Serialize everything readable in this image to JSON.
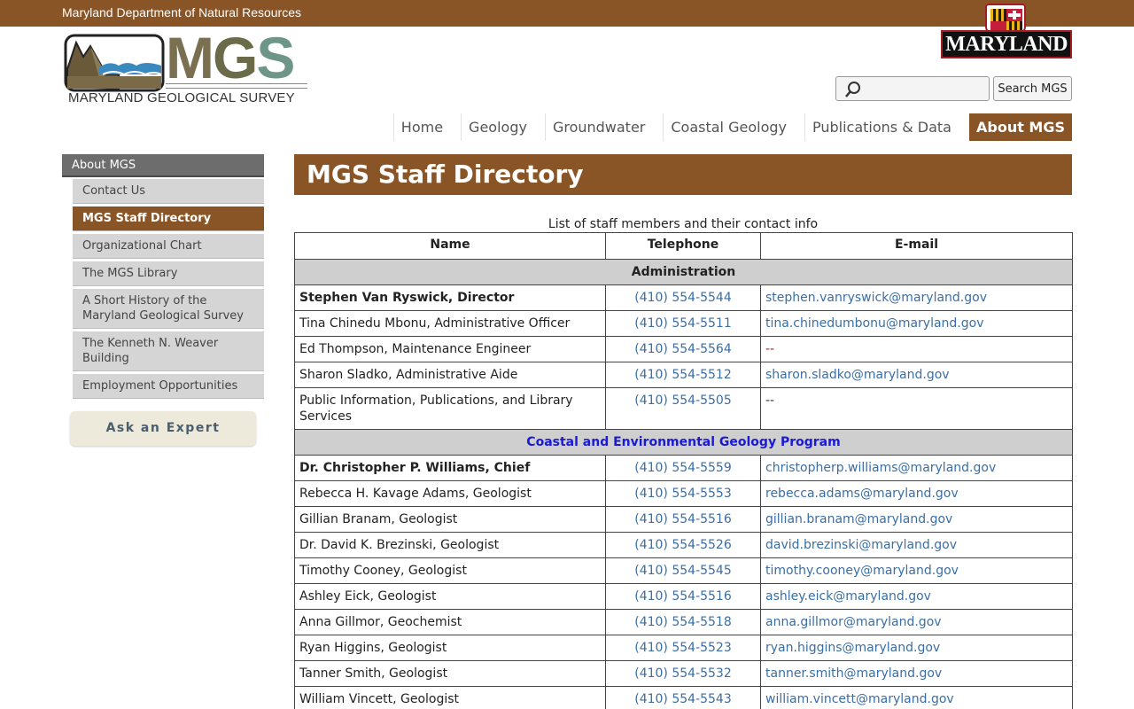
{
  "topbar": {
    "agency": "Maryland Department of Natural Resources"
  },
  "badge": {
    "word": "MARYLAND"
  },
  "logo": {
    "letters_m": "M",
    "letters_g": "G",
    "letters_s": "S",
    "subtitle": "MARYLAND GEOLOGICAL SURVEY"
  },
  "search": {
    "placeholder": "",
    "button": "Search MGS"
  },
  "nav": [
    {
      "label": "Home"
    },
    {
      "label": "Geology"
    },
    {
      "label": "Groundwater"
    },
    {
      "label": "Coastal Geology"
    },
    {
      "label": "Publications & Data"
    },
    {
      "label": "About MGS"
    }
  ],
  "sidebar": {
    "heading": "About MGS",
    "items": [
      {
        "label": "Contact Us"
      },
      {
        "label": "MGS Staff Directory"
      },
      {
        "label": "Organizational Chart"
      },
      {
        "label": "The MGS Library"
      },
      {
        "label": "A Short History of the Maryland Geological Survey"
      },
      {
        "label": "The Kenneth N. Weaver Building"
      },
      {
        "label": "Employment Opportunities"
      }
    ],
    "ask": "Ask an Expert"
  },
  "page": {
    "title": "MGS Staff Directory",
    "caption": "List of staff members and their contact info"
  },
  "table": {
    "headers": {
      "name": "Name",
      "tel": "Telephone",
      "mail": "E-mail"
    },
    "sections": [
      {
        "title": "Administration",
        "rows": [
          {
            "name": "Stephen Van Ryswick, Director",
            "tel": "(410) 554-5544",
            "mail": "stephen.vanryswick@maryland.gov"
          },
          {
            "name": "Tina Chinedu Mbonu, Administrative Officer",
            "tel": "(410) 554-5511",
            "mail": "tina.chinedumbonu@maryland.gov"
          },
          {
            "name": "Ed Thompson, Maintenance Engineer",
            "tel": "(410) 554-5564",
            "mail": "--"
          },
          {
            "name": "Sharon Sladko, Administrative Aide",
            "tel": "(410) 554-5512",
            "mail": "sharon.sladko@maryland.gov"
          },
          {
            "name": "Public Information, Publications, and Library Services",
            "tel": "(410) 554-5505",
            "mail": "--"
          }
        ]
      },
      {
        "title": "Coastal and Environmental Geology Program",
        "rows": [
          {
            "name": "Dr. Christopher P. Williams, Chief",
            "tel": "(410) 554-5559",
            "mail": "christopherp.williams@maryland.gov"
          },
          {
            "name": "Rebecca H. Kavage Adams, Geologist",
            "tel": "(410) 554-5553",
            "mail": "rebecca.adams@maryland.gov"
          },
          {
            "name": "Gillian Branam, Geologist",
            "tel": "(410) 554-5516",
            "mail": "gillian.branam@maryland.gov"
          },
          {
            "name": "Dr. David K. Brezinski, Geologist",
            "tel": "(410) 554-5526",
            "mail": "david.brezinski@maryland.gov"
          },
          {
            "name": "Timothy Cooney, Geologist",
            "tel": "(410) 554-5545",
            "mail": "timothy.cooney@maryland.gov"
          },
          {
            "name": "Ashley Eick, Geologist",
            "tel": "(410) 554-5516",
            "mail": "ashley.eick@maryland.gov"
          },
          {
            "name": "Anna Gillmor, Geochemist",
            "tel": "(410) 554-5518",
            "mail": "anna.gillmor@maryland.gov"
          },
          {
            "name": "Ryan Higgins, Geologist",
            "tel": "(410) 554-5523",
            "mail": "ryan.higgins@maryland.gov"
          },
          {
            "name": "Tanner Smith, Geologist",
            "tel": "(410) 554-5532",
            "mail": "tanner.smith@maryland.gov"
          },
          {
            "name": "William Vincett, Geologist",
            "tel": "(410) 554-5543",
            "mail": "william.vincett@maryland.gov"
          }
        ]
      }
    ]
  },
  "colors": {
    "brand_brown": "#8a5526",
    "link_blue": "#3a6ea5",
    "section_blue": "#1a1ad6"
  }
}
